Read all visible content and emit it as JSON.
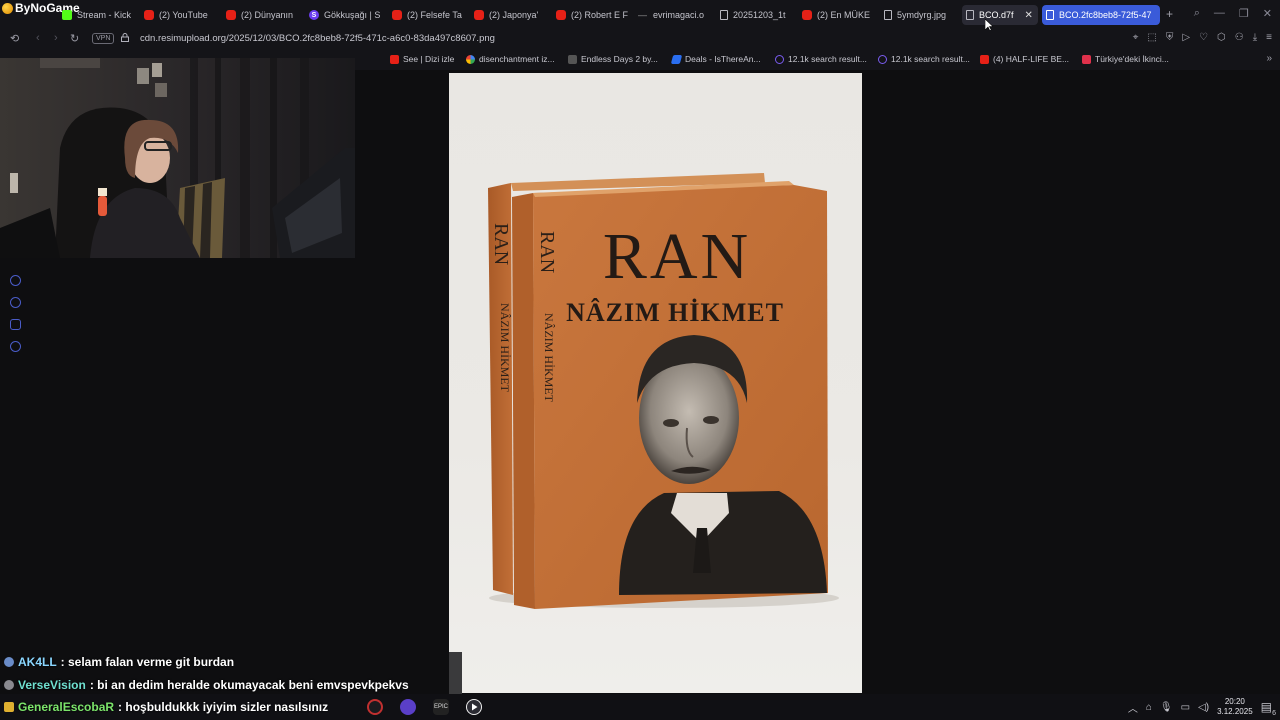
{
  "stream": {
    "logo_text": "ByNoGame"
  },
  "tabs": [
    {
      "label": "Stream - Kick",
      "icon": "kick-icon"
    },
    {
      "label": "(2) YouTube",
      "icon": "youtube-icon"
    },
    {
      "label": "(2) Dünyanın",
      "icon": "youtube-icon"
    },
    {
      "label": "Gökkuşağı | S",
      "icon": "s-icon"
    },
    {
      "label": "(2) Felsefe Ta",
      "icon": "youtube-icon"
    },
    {
      "label": "(2) Japonya'",
      "icon": "youtube-icon"
    },
    {
      "label": "(2) Robert E F",
      "icon": "youtube-icon"
    },
    {
      "label": "evrimagaci.o",
      "icon": "dash-icon"
    },
    {
      "label": "20251203_1t",
      "icon": "document-icon"
    },
    {
      "label": "(2) En MÜKE",
      "icon": "youtube-icon"
    },
    {
      "label": "5ymdyrg.jpg",
      "icon": "document-icon"
    },
    {
      "label": "BCO.d7f",
      "icon": "document-icon",
      "close": "✕"
    },
    {
      "label": "BCO.2fc8beb8-72f5-47",
      "icon": "document-icon"
    }
  ],
  "new_tab": "+",
  "address": {
    "vpn": "VPN",
    "url": "cdn.resimupload.org/2025/12/03/BCO.2fc8beb8-72f5-471c-a6c0-83da497c8607.png"
  },
  "bookmarks": [
    {
      "label": "See | Dizi izle",
      "icon": "play-icon"
    },
    {
      "label": "disenchantment iz...",
      "icon": "google-icon"
    },
    {
      "label": "Endless Days 2 by...",
      "icon": "site-icon"
    },
    {
      "label": "Deals - IsThereAn...",
      "icon": "deals-icon"
    },
    {
      "label": "12.1k search result...",
      "icon": "search-icon"
    },
    {
      "label": "12.1k search result...",
      "icon": "search-icon"
    },
    {
      "label": "(4) HALF-LIFE BE...",
      "icon": "youtube-icon"
    },
    {
      "label": "Türkiye'deki İkinci...",
      "icon": "red-icon"
    }
  ],
  "book": {
    "title": "RAN",
    "author": "NÂZIM HİKMET",
    "spine_title": "RAN",
    "spine_author": "NÂZIM HİKMET"
  },
  "chat": [
    {
      "user": "AK4LL",
      "message": ": selam falan verme git burdan",
      "color": "#8ad6ff"
    },
    {
      "user": "VerseVision",
      "message": ": bi an dedim heralde okumayacak beni emvspevkpekvs",
      "color": "#6fe0d0"
    },
    {
      "user": "GeneralEscobaR",
      "message": ": hoşbuldukkk iyiyim sizler nasılsınız",
      "color": "#7be36a"
    }
  ],
  "tray": {
    "time": "20:20",
    "date": "3.12.2025",
    "notifications": "6"
  },
  "colors": {
    "book_orange": "#c6743c",
    "accent_blue": "#3a5bd9",
    "background": "#0e0e10"
  }
}
